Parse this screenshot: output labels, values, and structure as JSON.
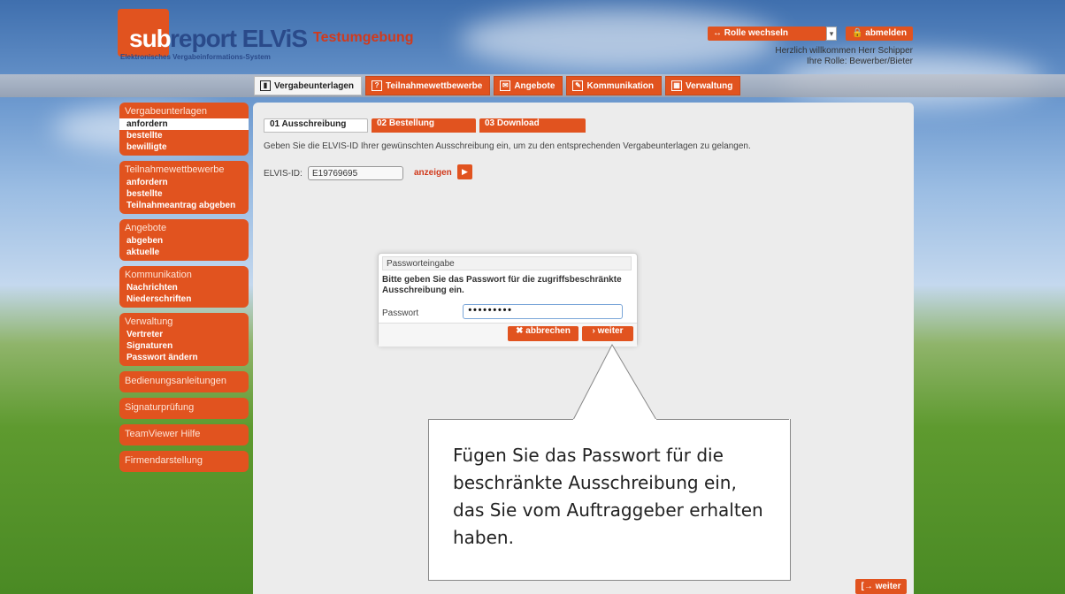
{
  "header": {
    "logo_sub": "sub",
    "logo_report": "report ELViS",
    "tagline": "Elektronisches Vergabeinformations-System",
    "environment": "Testumgebung",
    "role_select": "↔ Rolle wechseln",
    "logout": "abmelden",
    "welcome": "Herzlich willkommen Herr Schipper",
    "role": "Ihre Rolle: Bewerber/Bieter"
  },
  "topnav": [
    {
      "label": "Vergabeunterlagen",
      "icon": "folder-icon",
      "active": true
    },
    {
      "label": "Teilnahmewettbewerbe",
      "icon": "document-icon"
    },
    {
      "label": "Angebote",
      "icon": "offers-icon"
    },
    {
      "label": "Kommunikation",
      "icon": "mail-icon"
    },
    {
      "label": "Verwaltung",
      "icon": "grid-icon"
    }
  ],
  "sidebar": {
    "vergabe": {
      "title": "Vergabeunterlagen",
      "items": [
        "anfordern",
        "bestellte",
        "bewilligte"
      ]
    },
    "teilnahme": {
      "title": "Teilnahmewettbewerbe",
      "items": [
        "anfordern",
        "bestellte",
        "Teilnahmeantrag abgeben"
      ]
    },
    "angebote": {
      "title": "Angebote",
      "items": [
        "abgeben",
        "aktuelle"
      ]
    },
    "kommunikation": {
      "title": "Kommunikation",
      "items": [
        "Nachrichten",
        "Niederschriften"
      ]
    },
    "verwaltung": {
      "title": "Verwaltung",
      "items": [
        "Vertreter",
        "Signaturen",
        "Passwort ändern"
      ]
    },
    "singles": [
      "Bedienungsanleitungen",
      "Signaturprüfung",
      "TeamViewer Hilfe",
      "Firmendarstellung"
    ]
  },
  "main": {
    "tabs": [
      "01 Ausschreibung",
      "02 Bestellung",
      "03 Download"
    ],
    "instruction": "Geben Sie die ELVIS-ID Ihrer gewünschten Ausschreibung ein, um zu den entsprechenden Vergabeunterlagen zu gelangen.",
    "id_label": "ELVIS-ID:",
    "id_value": "E19769695",
    "show_label": "anzeigen",
    "bottom_next": "[→ weiter"
  },
  "dialog": {
    "title": "Passworteingabe",
    "message": "Bitte geben Sie das Passwort für die zugriffsbeschränkte Ausschreibung ein.",
    "password_label": "Passwort",
    "password_value": "•••••••••",
    "cancel": "✖ abbrechen",
    "next": "› weiter"
  },
  "callout": {
    "text": "Fügen Sie das Passwort für die beschränkte Ausschreibung ein, das Sie vom Auftraggeber erhalten haben."
  },
  "colors": {
    "accent": "#e1531f",
    "brand_blue": "#2a4a8a"
  }
}
